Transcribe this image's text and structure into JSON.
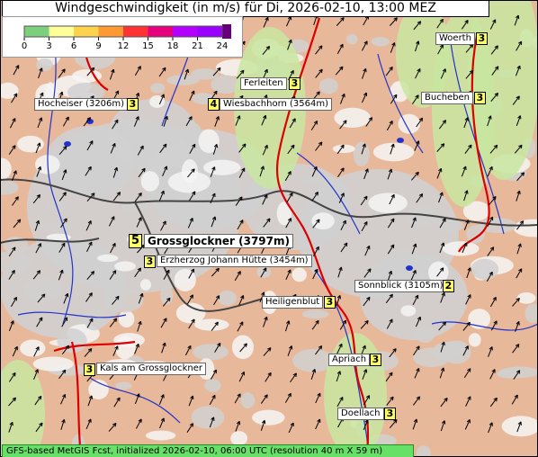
{
  "title": "Windgeschwindigkeit (in m/s) für Di, 2026-02-10, 13:00 MEZ",
  "legend": {
    "ticks": [
      "0",
      "3",
      "6",
      "9",
      "12",
      "15",
      "18",
      "21",
      "24"
    ],
    "colors": [
      "#7ccf7c",
      "#ffff99",
      "#ffd24d",
      "#ff9933",
      "#ff3333",
      "#e6007e",
      "#b300ff",
      "#9900ff",
      "#66007a"
    ]
  },
  "places": [
    {
      "id": "woerth",
      "name": "Woerth",
      "value": "3"
    },
    {
      "id": "ferleiten",
      "name": "Ferleiten",
      "value": "3"
    },
    {
      "id": "hocheiser",
      "name": "Hocheiser (3206m)",
      "value": "3"
    },
    {
      "id": "wiesbachhorn",
      "name": "Wiesbachhorn (3564m)",
      "value": "4"
    },
    {
      "id": "bucheben",
      "name": "Bucheben",
      "value": "3"
    },
    {
      "id": "grossglockner",
      "name": "Grossglockner (3797m)",
      "value": "5"
    },
    {
      "id": "erzherzog",
      "name": "Erzherzog Johann Hütte (3454m)",
      "value": "3"
    },
    {
      "id": "sonnblick",
      "name": "Sonnblick (3105m)",
      "value": "2"
    },
    {
      "id": "heiligenblut",
      "name": "Heiligenblut",
      "value": "3"
    },
    {
      "id": "apriach",
      "name": "Apriach",
      "value": "3"
    },
    {
      "id": "kals",
      "name": "Kals am Grossglockner",
      "value": "3"
    },
    {
      "id": "doellach",
      "name": "Doellach",
      "value": "3"
    }
  ],
  "footer": "GFS-based MetGIS Fcst, initialized 2026-02-10, 06:00 UTC  (resolution 40 m X 59 m)",
  "colors": {
    "terrain_low": "#c8e6a0",
    "terrain_mid": "#e8b89a",
    "terrain_high": "#d0d0d0",
    "snow": "#f4f4f4",
    "rivers": "#2233cc",
    "roads": "#dd0000",
    "borders": "#444444",
    "label_value_bg": "#ffff66"
  }
}
